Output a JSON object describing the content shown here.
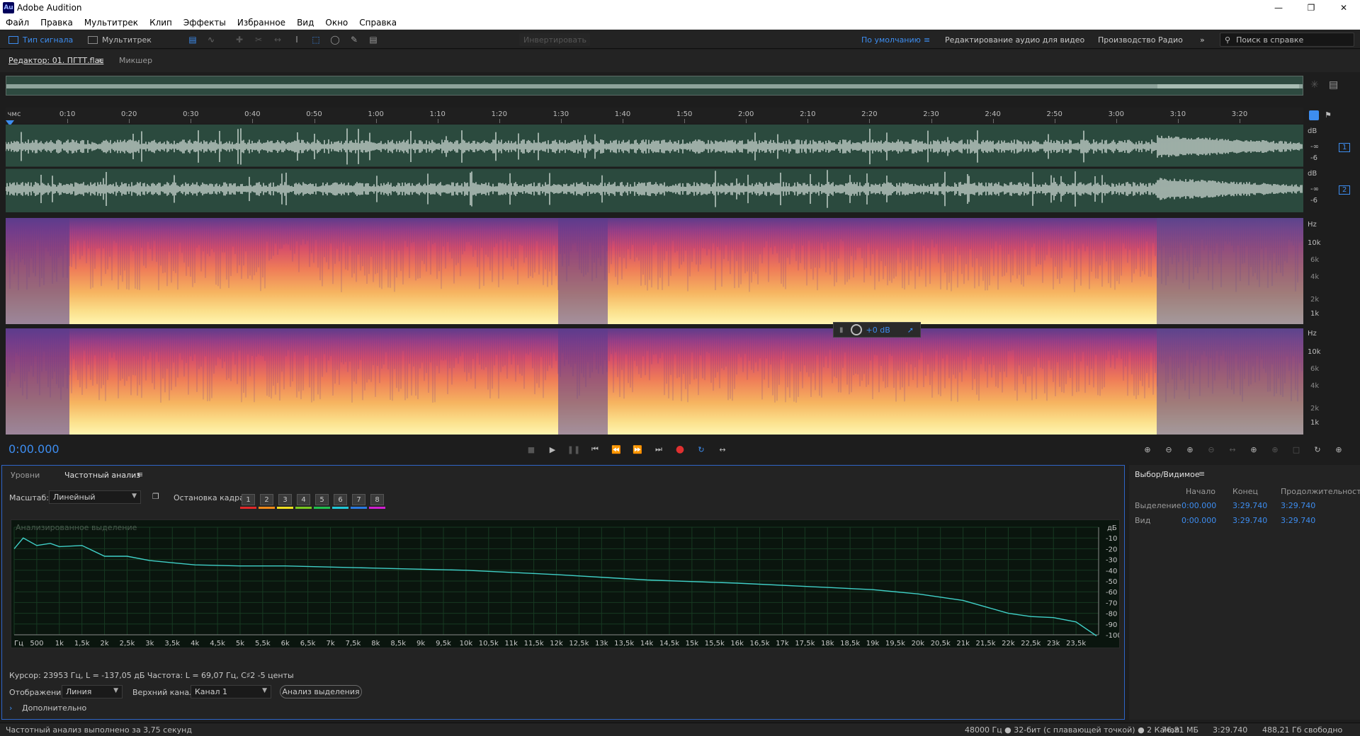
{
  "window": {
    "title": "Adobe Audition",
    "icon_text": "Au"
  },
  "menu": [
    "Файл",
    "Правка",
    "Мультитрек",
    "Клип",
    "Эффекты",
    "Избранное",
    "Вид",
    "Окно",
    "Справка"
  ],
  "toolbar": {
    "mode_waveform": "Тип сигнала",
    "mode_multitrack": "Мультитрек",
    "invert_label": "Инвертировать",
    "workspace_default": "По умолчанию",
    "workspace_video": "Редактирование аудио для видео",
    "workspace_radio": "Производство Радио",
    "help_placeholder": "Поиск в справке"
  },
  "editor": {
    "tab_editor": "Редактор: 01. ПГТТ.flac",
    "tab_mixer": "Микшер"
  },
  "ruler": {
    "start": "чмс",
    "labels": [
      "0:10",
      "0:20",
      "0:30",
      "0:40",
      "0:50",
      "1:00",
      "1:10",
      "1:20",
      "1:30",
      "1:40",
      "1:50",
      "2:00",
      "2:10",
      "2:20",
      "2:30",
      "2:40",
      "2:50",
      "3:00",
      "3:10",
      "3:20"
    ]
  },
  "waveform_scale": {
    "db": "dB",
    "minus_inf": "-∞",
    "minus6": "-6",
    "ch1": "1",
    "ch2": "2"
  },
  "spectral_scale": {
    "hz": "Hz",
    "k10": "10k",
    "k6": "6k",
    "k4": "4k",
    "k2": "2k",
    "k1": "1k"
  },
  "hud": {
    "gain": "+0 dB"
  },
  "transport": {
    "time": "0:00.000"
  },
  "freq_panel": {
    "tab_levels": "Уровни",
    "tab_freq": "Частотный анализ",
    "scale_label": "Масштаб:",
    "scale_value": "Линейный",
    "freeze_label": "Остановка кадра:",
    "keys": [
      "1",
      "2",
      "3",
      "4",
      "5",
      "6",
      "7",
      "8"
    ],
    "key_colors": [
      "#e0282a",
      "#f08a1a",
      "#f0e020",
      "#7ac820",
      "#20c050",
      "#20c8d8",
      "#2a7ae0",
      "#d020d0"
    ],
    "graph_label": "Анализированное выделение",
    "db_unit": "дБ",
    "db_ticks": [
      "-10",
      "-20",
      "-30",
      "-40",
      "-50",
      "-60",
      "-70",
      "-80",
      "-90",
      "-100"
    ],
    "freq_ticks": [
      "Гц",
      "500",
      "1k",
      "1,5k",
      "2k",
      "2,5k",
      "3k",
      "3,5k",
      "4k",
      "4,5k",
      "5k",
      "5,5k",
      "6k",
      "6,5k",
      "7k",
      "7,5k",
      "8k",
      "8,5k",
      "9k",
      "9,5k",
      "10k",
      "10,5k",
      "11k",
      "11,5k",
      "12k",
      "12,5k",
      "13k",
      "13,5k",
      "14k",
      "14,5k",
      "15k",
      "15,5k",
      "16k",
      "16,5k",
      "17k",
      "17,5k",
      "18k",
      "18,5k",
      "19k",
      "19,5k",
      "20k",
      "20,5k",
      "21k",
      "21,5k",
      "22k",
      "22,5k",
      "23k",
      "23,5k"
    ],
    "cursor_info": "Курсор: 23953 Гц, L = -137,05 дБ Частота: L = 69,07 Гц, C♯2 -5 центы",
    "display_label": "Отображение:",
    "display_value": "Линия",
    "channel_label": "Верхний канал:",
    "channel_value": "Канал 1",
    "analyze_button": "Анализ выделения",
    "more_label": "Дополнительно"
  },
  "sel_panel": {
    "title": "Выбор/Видимое",
    "col_start": "Начало",
    "col_end": "Конец",
    "col_dur": "Продолжительность",
    "rows": [
      {
        "label": "Выделение",
        "start": "0:00.000",
        "end": "3:29.740",
        "dur": "3:29.740"
      },
      {
        "label": "Вид",
        "start": "0:00.000",
        "end": "3:29.740",
        "dur": "3:29.740"
      }
    ]
  },
  "status": {
    "left": "Частотный анализ выполнено за 3,75 секунд",
    "format": "48000 Гц ● 32-бит (с плавающей точкой) ● 2 Канал",
    "size": "76,81 МБ",
    "duration": "3:29.740",
    "free": "488,21 Гб свободно"
  },
  "chart_data": {
    "type": "line",
    "title": "",
    "xlabel": "Гц",
    "ylabel": "дБ",
    "xlim": [
      0,
      24000
    ],
    "ylim": [
      -100,
      0
    ],
    "grid": true,
    "x": [
      0,
      200,
      500,
      800,
      1000,
      1500,
      2000,
      2500,
      3000,
      4000,
      5000,
      6000,
      8000,
      10000,
      12000,
      14000,
      16000,
      18000,
      19000,
      20000,
      21000,
      22000,
      22500,
      23000,
      23500,
      23953
    ],
    "series": [
      {
        "values": [
          -20,
          -10,
          -17,
          -15,
          -18,
          -17,
          -27,
          -27,
          -31,
          -35,
          -36,
          -36,
          -38,
          -40,
          -44,
          -49,
          -52,
          -56,
          -58,
          -62,
          -68,
          -80,
          -83,
          -84,
          -88,
          -101
        ]
      }
    ]
  }
}
